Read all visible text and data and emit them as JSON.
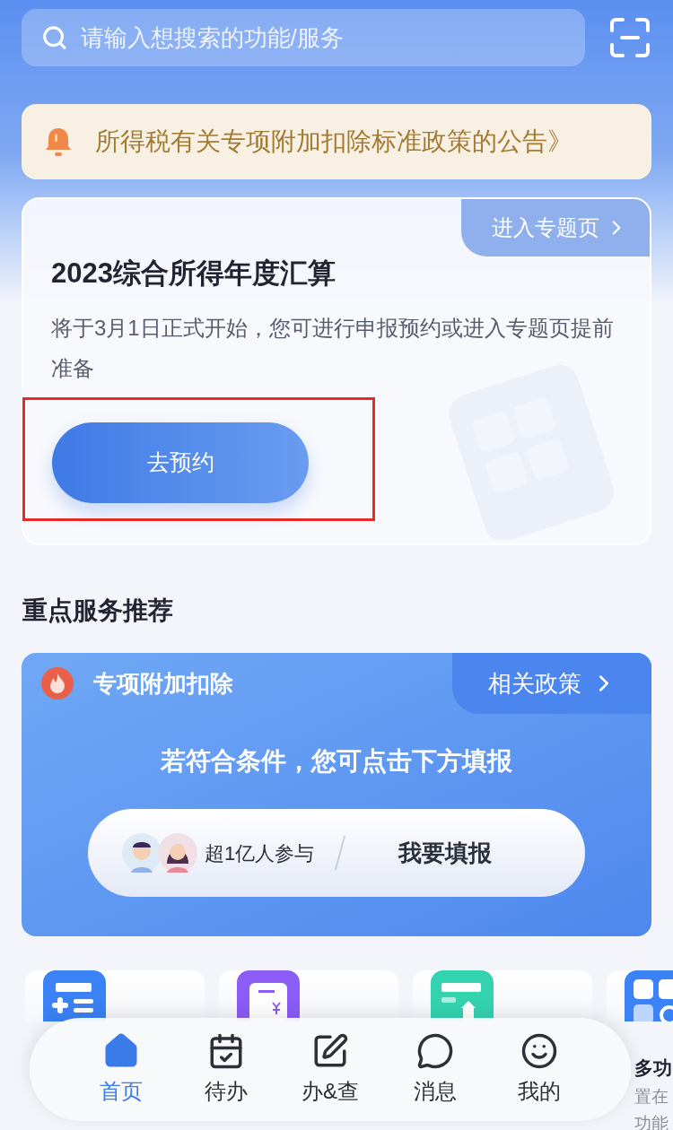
{
  "search": {
    "placeholder": "请输入想搜索的功能/服务"
  },
  "notice": {
    "text": "所得税有关专项附加扣除标准政策的公告》"
  },
  "annual_card": {
    "tab": "进入专题页",
    "title": "2023综合所得年度汇算",
    "description": "将于3月1日正式开始，您可进行申报预约或进入专题页提前准备",
    "button": "去预约",
    "highlighted": true
  },
  "section_title": "重点服务推荐",
  "deduction_card": {
    "title": "专项附加扣除",
    "link": "相关政策",
    "prompt": "若符合条件，您可点击下方填报",
    "participants": "超1亿人参与",
    "action": "我要填报"
  },
  "services": [
    {
      "kind": "form",
      "color": "#3b82f6"
    },
    {
      "kind": "receipt",
      "color": "#8b5cf6"
    },
    {
      "kind": "card",
      "color": "#34d3b0"
    },
    {
      "kind": "grid",
      "color": "#3b82f6",
      "title": "多功",
      "description": [
        "置在",
        "功能"
      ]
    }
  ],
  "nav": [
    {
      "label": "首页",
      "selected": true
    },
    {
      "label": "待办",
      "selected": false
    },
    {
      "label": "办&查",
      "selected": false
    },
    {
      "label": "消息",
      "selected": false
    },
    {
      "label": "我的",
      "selected": false
    }
  ]
}
